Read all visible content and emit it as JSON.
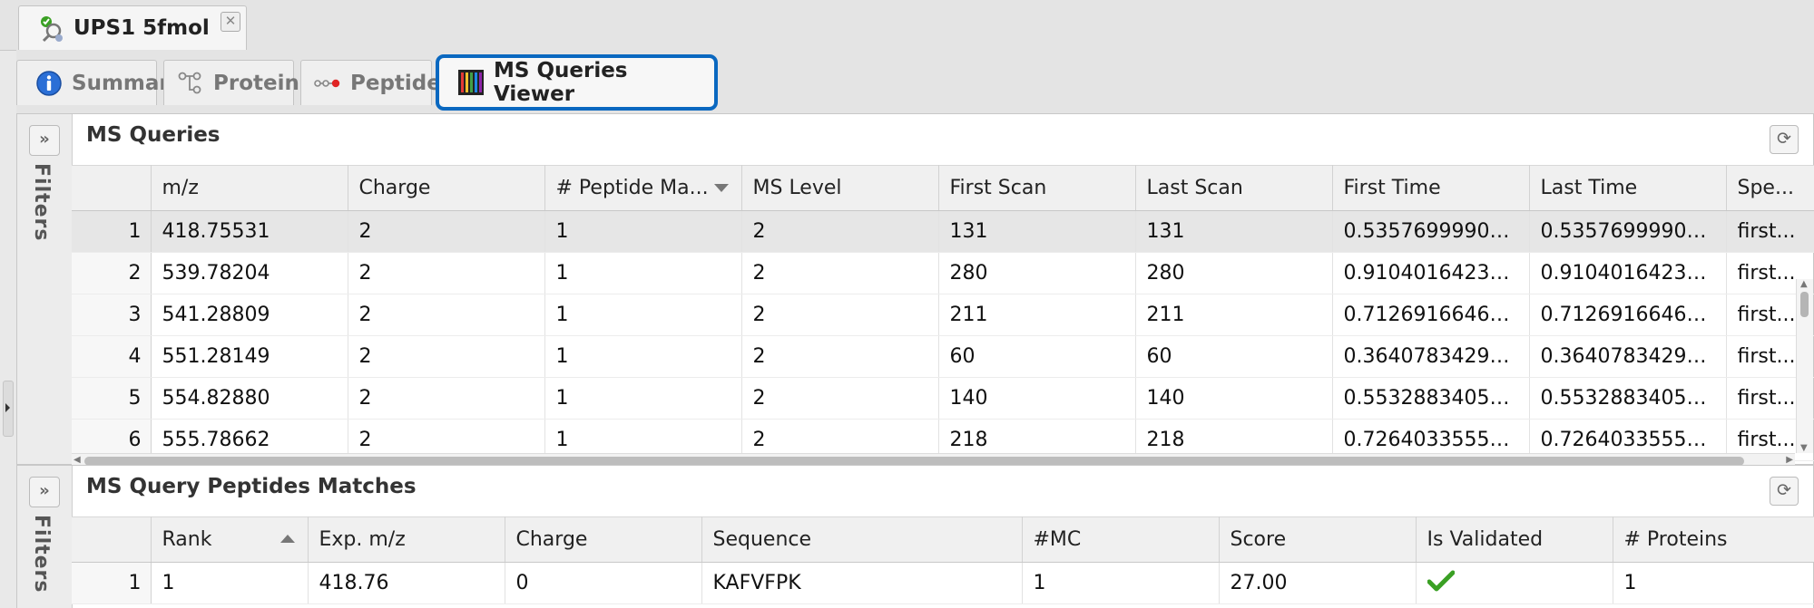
{
  "document_tab": {
    "title": "UPS1 5fmol",
    "close_label": "✕"
  },
  "tabs": [
    {
      "label": "Summary",
      "icon": "info-icon",
      "active": false
    },
    {
      "label": "Proteins",
      "icon": "protein-tree-icon",
      "active": false
    },
    {
      "label": "Peptides",
      "icon": "peptide-chain-icon",
      "active": false
    },
    {
      "label": "MS Queries Viewer",
      "icon": "ms-spectrum-icon",
      "active": true
    }
  ],
  "filters_label": "Filters",
  "ms_queries": {
    "title": "MS Queries",
    "columns": [
      "",
      "m/z",
      "Charge",
      "# Peptide Ma...",
      "MS Level",
      "First Scan",
      "Last Scan",
      "First Time",
      "Last Time",
      "Spe..."
    ],
    "rows": [
      [
        "1",
        "418.75531",
        "2",
        "1",
        "2",
        "131",
        "131",
        "0.535769999027...",
        "0.535769999027...",
        "first..."
      ],
      [
        "2",
        "539.78204",
        "2",
        "1",
        "2",
        "280",
        "280",
        "0.910401642322...",
        "0.910401642322...",
        "first..."
      ],
      [
        "3",
        "541.28809",
        "2",
        "1",
        "2",
        "211",
        "211",
        "0.712691664695...",
        "0.712691664695...",
        "first..."
      ],
      [
        "4",
        "551.28149",
        "2",
        "1",
        "2",
        "60",
        "60",
        "0.364078342914...",
        "0.364078342914...",
        "first..."
      ],
      [
        "5",
        "554.82880",
        "2",
        "1",
        "2",
        "140",
        "140",
        "0.553288340568...",
        "0.553288340568...",
        "first..."
      ],
      [
        "6",
        "555.78662",
        "2",
        "1",
        "2",
        "218",
        "218",
        "0.726403355598...",
        "0.726403355598...",
        "first..."
      ]
    ]
  },
  "peptide_matches": {
    "title": "MS Query Peptides Matches",
    "columns": [
      "",
      "Rank",
      "Exp. m/z",
      "Charge",
      "Sequence",
      "#MC",
      "Score",
      "Is Validated",
      "# Proteins"
    ],
    "rows": [
      [
        "1",
        "1",
        "418.76",
        "0",
        "KAFVFPK",
        "1",
        "27.00",
        "validated-check-icon",
        "1"
      ]
    ]
  },
  "colors": {
    "active_tab_border": "#0a68c0",
    "check_green": "#3aa024",
    "info_blue": "#2b6fd6"
  }
}
